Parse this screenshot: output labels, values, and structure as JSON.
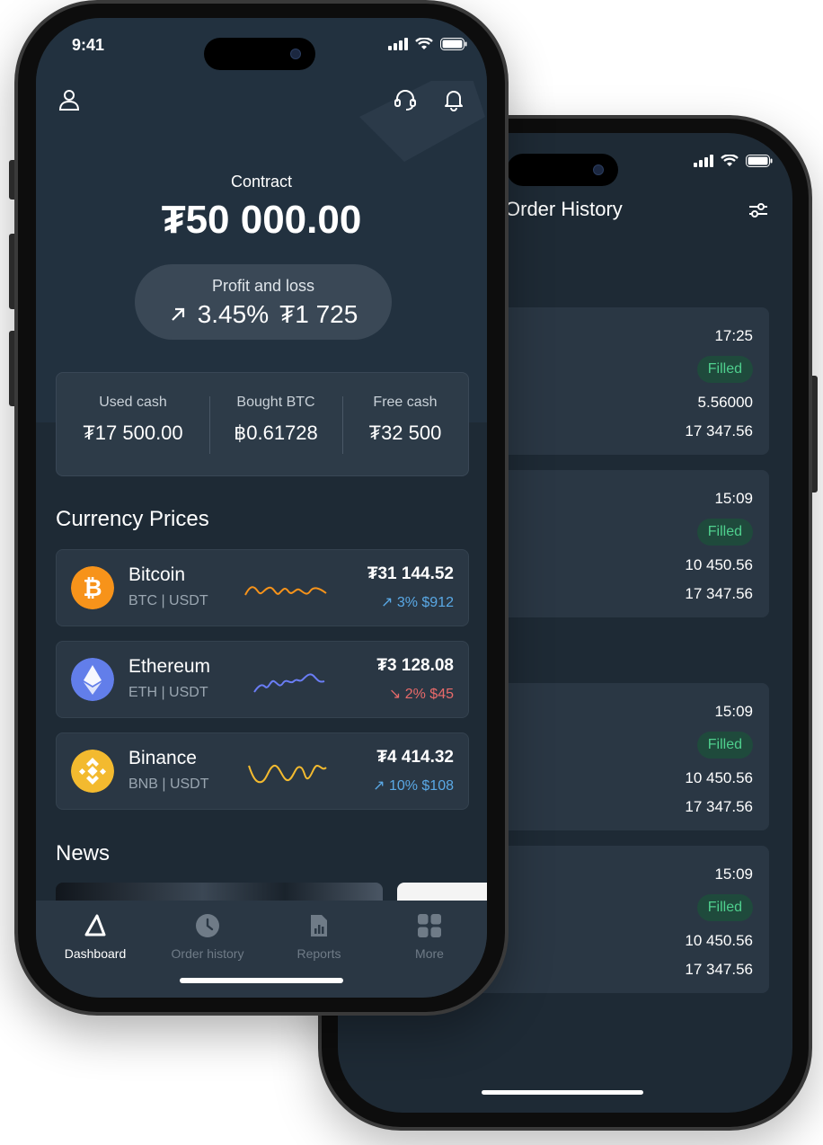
{
  "status": {
    "time": "9:41"
  },
  "dashboard": {
    "contract_label": "Contract",
    "contract_value": "₮50 000.00",
    "pnl_label": "Profit and loss",
    "pnl_percent": "3.45%",
    "pnl_amount": "₮1 725",
    "stats": [
      {
        "label": "Used cash",
        "value": "₮17 500.00"
      },
      {
        "label": "Bought BTC",
        "value": "฿0.61728"
      },
      {
        "label": "Free cash",
        "value": "₮32 500"
      }
    ],
    "currency_title": "Currency Prices",
    "currencies": [
      {
        "name": "Bitcoin",
        "pair": "BTC | USDT",
        "price": "₮31 144.52",
        "change": "3% $912",
        "direction": "up",
        "change_color": "#5aa9e6",
        "logo_color": "#f7931a",
        "spark_color": "#f7931a"
      },
      {
        "name": "Ethereum",
        "pair": "ETH | USDT",
        "price": "₮3 128.08",
        "change": "2% $45",
        "direction": "down",
        "change_color": "#e86a6a",
        "logo_color": "#627eea",
        "spark_color": "#6a7df5"
      },
      {
        "name": "Binance",
        "pair": "BNB | USDT",
        "price": "₮4 414.32",
        "change": "10% $108",
        "direction": "up",
        "change_color": "#5aa9e6",
        "logo_color": "#f3ba2f",
        "spark_color": "#f3ba2f"
      }
    ],
    "news_title": "News"
  },
  "tabs": [
    {
      "label": "Dashboard",
      "icon": "triangle-logo-icon",
      "active": true
    },
    {
      "label": "Order history",
      "icon": "clock-icon",
      "active": false
    },
    {
      "label": "Reports",
      "icon": "report-icon",
      "active": false
    },
    {
      "label": "More",
      "icon": "grid-icon",
      "active": false
    }
  ],
  "order_history": {
    "title": "Order History",
    "orders": [
      {
        "time": "17:25",
        "status": "Filled",
        "amount": "5.56000",
        "price": "17 347.56"
      },
      {
        "time": "15:09",
        "status": "Filled",
        "amount": "10 450.56",
        "price": "17 347.56"
      },
      {
        "time": "15:09",
        "status": "Filled",
        "amount": "10 450.56",
        "price": "17 347.56"
      },
      {
        "time": "15:09",
        "status": "Filled",
        "amount": "10 450.56",
        "price": "17 347.56"
      }
    ]
  },
  "colors": {
    "background": "#1e2a35",
    "card": "#2a3744",
    "filled": "#4fd08e",
    "up": "#5aa9e6",
    "down": "#e86a6a"
  }
}
